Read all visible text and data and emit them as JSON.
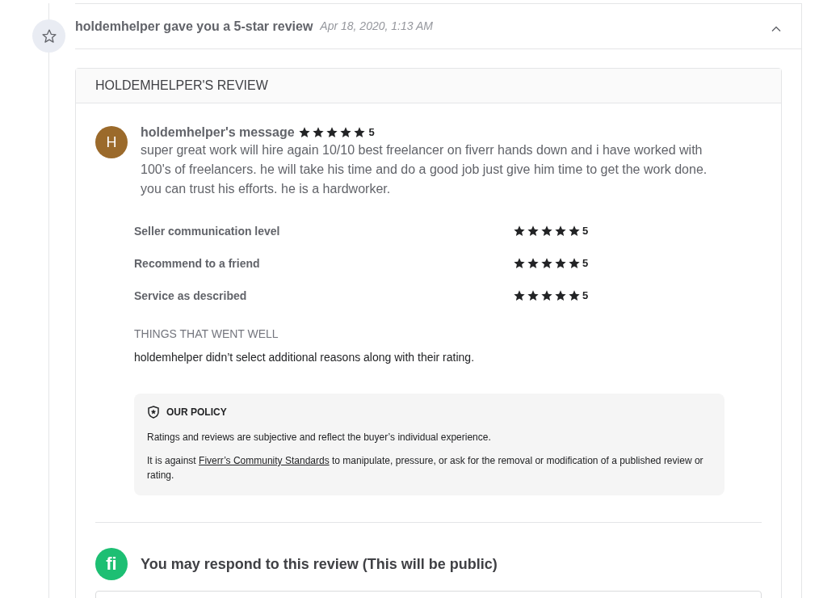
{
  "activity": {
    "title": "holdemhelper gave you a 5-star review",
    "time": "Apr 18, 2020, 1:13 AM",
    "expanded": true
  },
  "review": {
    "heading": "HOLDEMHELPER'S REVIEW",
    "avatar_letter": "H",
    "author_label": "holdemhelper's message",
    "stars": 5,
    "score": "5",
    "message": "super great work will hire again 10/10 best freelancer on fiverr hands down and i have worked with 100's of freelancers. he will take his time and do a good job just give him time to get the work done. you can trust his efforts. he is a hardworker.",
    "ratings": [
      {
        "label": "Seller communication level",
        "stars": 5,
        "score": "5"
      },
      {
        "label": "Recommend to a friend",
        "stars": 5,
        "score": "5"
      },
      {
        "label": "Service as described",
        "stars": 5,
        "score": "5"
      }
    ],
    "things_heading": "THINGS THAT WENT WELL",
    "things_text": "holdemhelper didn’t select additional reasons along with their rating.",
    "policy": {
      "title": "OUR POLICY",
      "line1": "Ratings and reviews are subjective and reflect the buyer’s individual experience.",
      "line2_before": "It is against",
      "link": "Fiverr’s Community Standards",
      "line2_after": "to manipulate, pressure, or ask for the removal or modification of a published review or rating."
    },
    "respond": {
      "logo_text": "fi",
      "title": "You may respond to this review (This will be public)"
    }
  }
}
